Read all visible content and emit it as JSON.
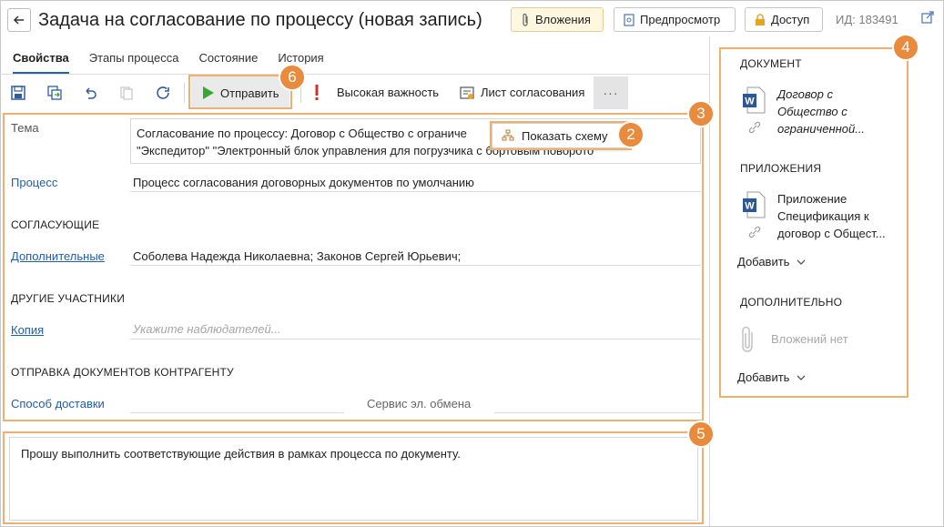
{
  "header": {
    "title": "Задача на согласование по процессу (новая запись)",
    "attachments_label": "Вложения",
    "preview_label": "Предпросмотр",
    "access_label": "Доступ",
    "id_label": "ИД: 183491"
  },
  "tabs": [
    {
      "label": "Свойства",
      "active": true
    },
    {
      "label": "Этапы процесса",
      "active": false
    },
    {
      "label": "Состояние",
      "active": false
    },
    {
      "label": "История",
      "active": false
    }
  ],
  "toolbar": {
    "send_label": "Отправить",
    "importance_label": "Высокая важность",
    "approval_sheet_label": "Лист согласования",
    "more_label": "···"
  },
  "form": {
    "subject_label": "Тема",
    "subject_line1": "Согласование по процессу: Договор с Общество с ограниче",
    "subject_line2": "\"Экспедитор\" \"Электронный блок управления для погрузчика с бортовым поворото",
    "show_scheme_label": "Показать схему",
    "process_label": "Процесс",
    "process_value": "Процесс согласования договорных документов по умолчанию",
    "approvers_section": "СОГЛАСУЮЩИЕ",
    "additional_label": "Дополнительные",
    "additional_value": "Соболева Надежда Николаевна; Законов Сергей Юрьевич;",
    "other_section": "ДРУГИЕ УЧАСТНИКИ",
    "copy_label": "Копия",
    "copy_placeholder": "Укажите наблюдателей...",
    "sending_section": "ОТПРАВКА ДОКУМЕНТОВ КОНТРАГЕНТУ",
    "delivery_label": "Способ доставки",
    "exchange_label": "Сервис эл. обмена",
    "comment": "Прошу выполнить соответствующие действия в рамках процесса по документу."
  },
  "right_panel": {
    "document_section": "ДОКУМЕНТ",
    "document_lines": [
      "Договор с",
      "Общество с",
      "ограниченной..."
    ],
    "attachments_section": "ПРИЛОЖЕНИЯ",
    "appendix_lines": [
      "Приложение",
      "Спецификация к",
      "договор с Общест..."
    ],
    "add_label": "Добавить",
    "additional_section": "ДОПОЛНИТЕЛЬНО",
    "no_attachments": "Вложений нет",
    "add_label2": "Добавить"
  },
  "badges": {
    "b2": "2",
    "b3": "3",
    "b4": "4",
    "b5": "5",
    "b6": "6"
  },
  "colors": {
    "accent_orange": "#e98b3c",
    "highlight": "#efaf6f",
    "link": "#1f5ea8",
    "send_green": "#3aa630",
    "importance_red": "#d0312d"
  }
}
